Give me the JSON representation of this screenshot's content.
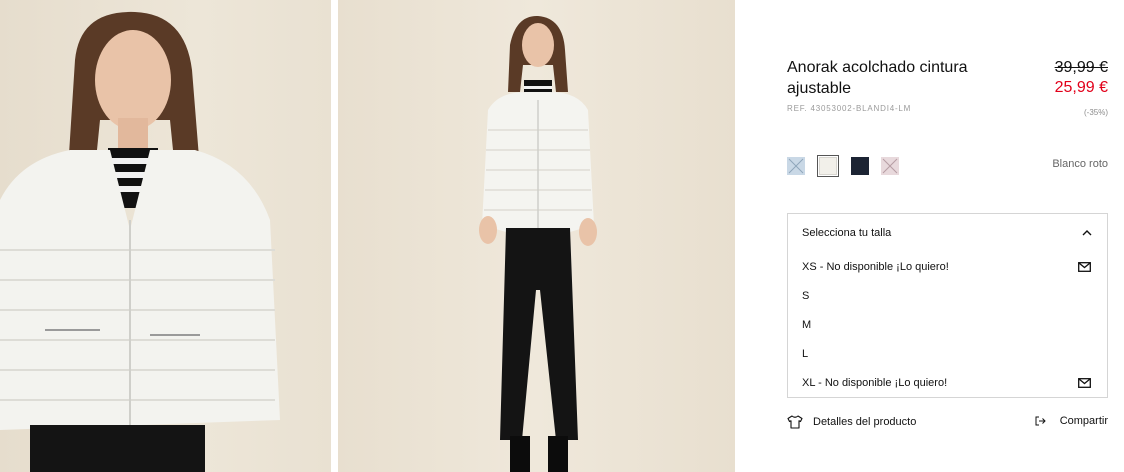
{
  "product": {
    "title": "Anorak acolchado cintura ajustable",
    "ref": "REF. 43053002-BLANDI4-LM",
    "price_old": "39,99 €",
    "price_new": "25,99 €",
    "discount": "(-35%)"
  },
  "colors": {
    "selected_name": "Blanco roto",
    "swatches": [
      {
        "name": "light-blue",
        "hex": "#c9d8e6",
        "available": false
      },
      {
        "name": "off-white",
        "hex": "#f2f0ea",
        "available": true,
        "selected": true
      },
      {
        "name": "navy",
        "hex": "#1c2433",
        "available": true
      },
      {
        "name": "pink",
        "hex": "#e8d9dc",
        "available": false
      }
    ],
    "price_red": "#e2001a"
  },
  "sizes": {
    "header": "Selecciona tu talla",
    "options": [
      {
        "label": "XS - No disponible ¡Lo quiero!",
        "available": false,
        "icon": "mail-icon"
      },
      {
        "label": "S",
        "available": true
      },
      {
        "label": "M",
        "available": true
      },
      {
        "label": "L",
        "available": true
      },
      {
        "label": "XL - No disponible ¡Lo quiero!",
        "available": false,
        "icon": "mail-icon"
      }
    ]
  },
  "footer": {
    "details_label": "Detalles del producto",
    "share_label": "Compartir"
  }
}
